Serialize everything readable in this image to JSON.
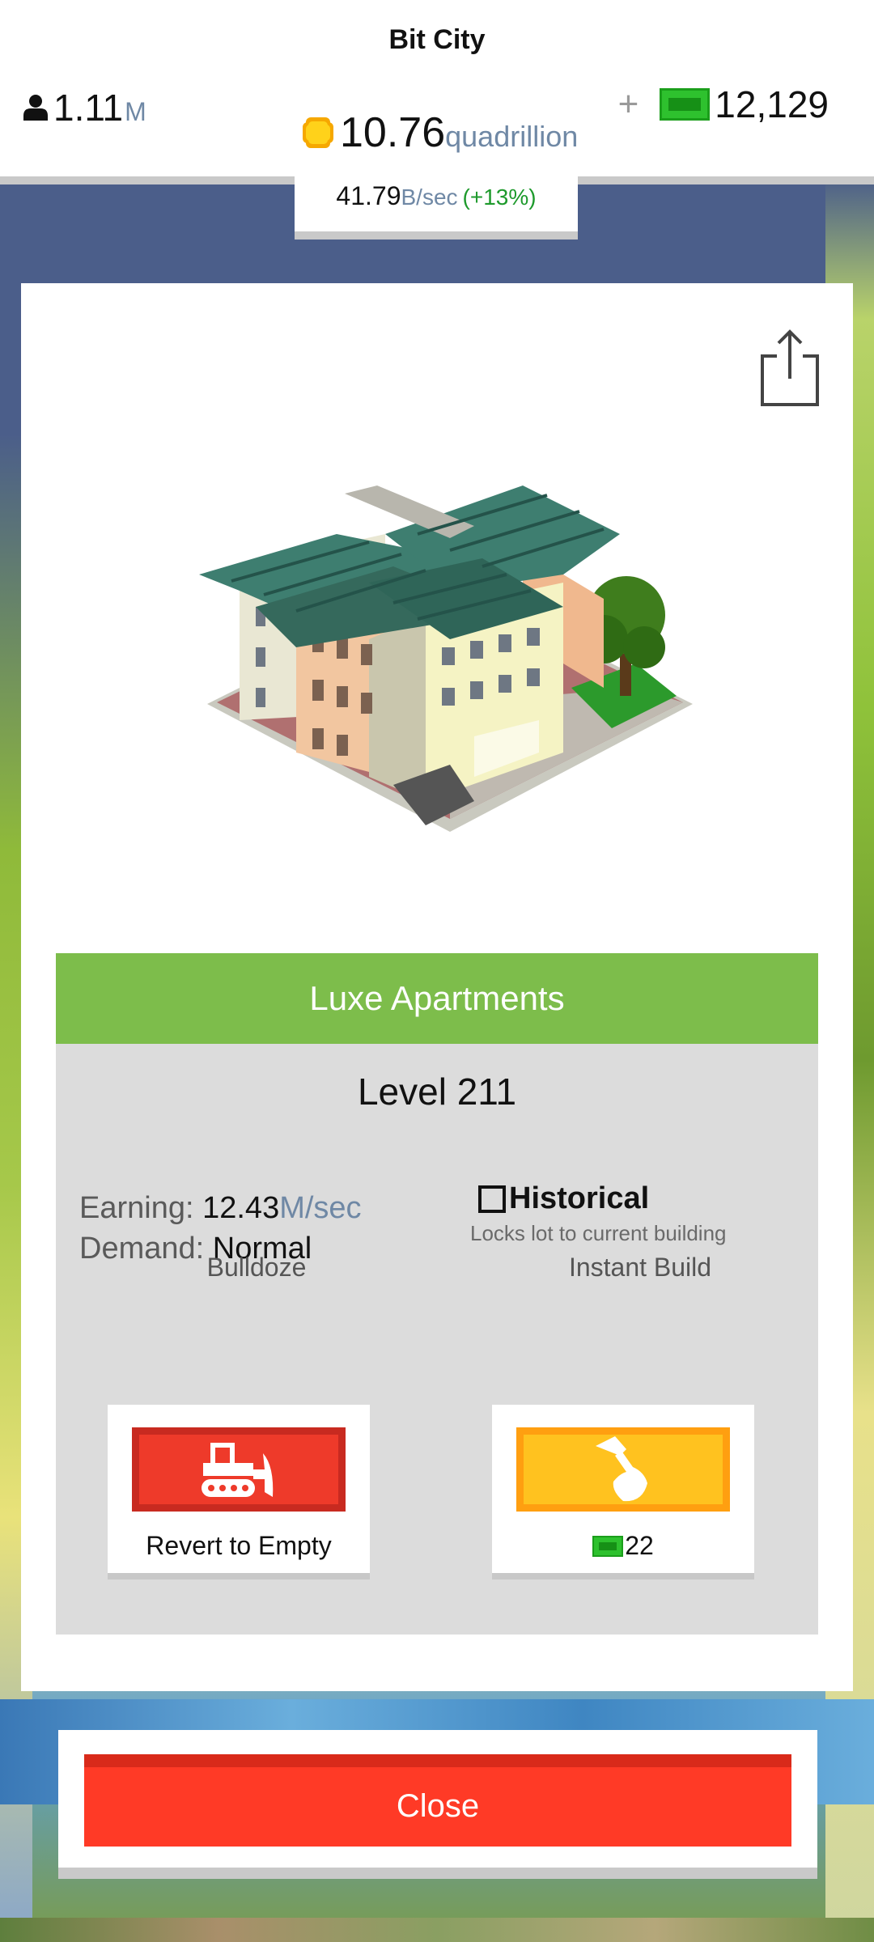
{
  "app": {
    "title": "Bit City"
  },
  "stats": {
    "population_value": "1.11",
    "population_unit": "M",
    "coins_value": "10.76",
    "coins_unit": "quadrillion",
    "cash_plus": "+",
    "cash_value": "12,129",
    "rate_value": "41.79",
    "rate_unit": "B/sec",
    "rate_change": "(+13%)"
  },
  "building": {
    "name": "Luxe Apartments",
    "level": "Level 211",
    "earning_label": "Earning:",
    "earning_value": "12.43",
    "earning_unit": "M/sec",
    "demand_label": "Demand:",
    "demand_value": "Normal",
    "historical_title": "Historical",
    "historical_desc": "Locks lot to current building",
    "historical_checked": false
  },
  "actions": {
    "bulldoze_label": "Bulldoze",
    "bulldoze_caption": "Revert to Empty",
    "instant_label": "Instant Build",
    "instant_cost": "22"
  },
  "footer": {
    "close_label": "Close"
  },
  "icons": {
    "population": "person-icon",
    "coins": "coin-icon",
    "cash": "cash-icon",
    "share": "share-icon",
    "bulldoze": "bulldozer-icon",
    "instant": "hammer-icon"
  },
  "colors": {
    "name_bar": "#7dbd4b",
    "bulldoze_button": "#ee3a2a",
    "instant_button": "#ffc21f",
    "close_button": "#ff3a26",
    "unit_text": "#6f88a5",
    "rate_change": "#1e9a2c"
  }
}
